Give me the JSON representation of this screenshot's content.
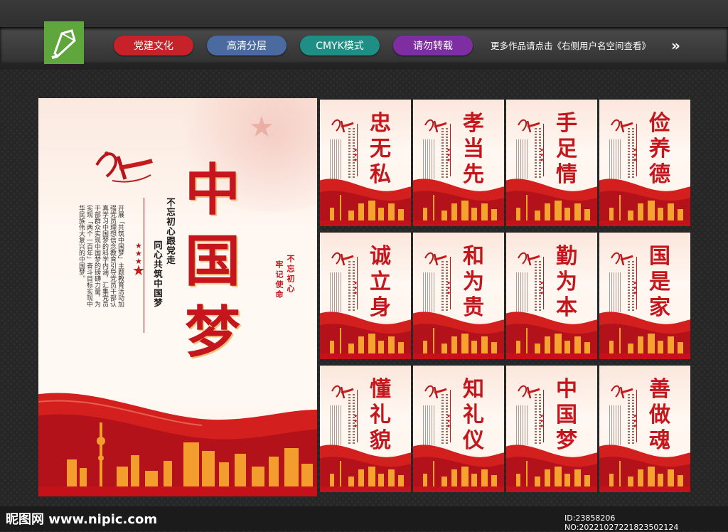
{
  "header": {
    "tags": [
      {
        "label": "党建文化",
        "color": "#c7222a"
      },
      {
        "label": "高清分层",
        "color": "#4a6aa0"
      },
      {
        "label": "CMYK模式",
        "color": "#1f8f86"
      },
      {
        "label": "请勿转载",
        "color": "#7e2ea0"
      }
    ],
    "more_text": "更多作品请点击《右侧用户名空间查看》",
    "arrow": "»"
  },
  "main_poster": {
    "title": "中国梦",
    "subtitle_1": "不忘初心跟党走",
    "subtitle_2": "同心共筑中国梦",
    "body": "开展「共筑中国梦」主题教育活动加强党员理想信念教育引导党员干部认真学习中国梦的科学内涵，汇集党员干部群众实现中国梦的磅礴力量，为实现「两个一百年」奋斗目标实现中华民族伟大复兴的中国梦。",
    "seal": [
      "不忘初心",
      "牢记使命"
    ]
  },
  "posters": [
    {
      "title": "忠无私"
    },
    {
      "title": "孝当先"
    },
    {
      "title": "手足情"
    },
    {
      "title": "俭养德"
    },
    {
      "title": "诚立身"
    },
    {
      "title": "和为贵"
    },
    {
      "title": "勤为本"
    },
    {
      "title": "国是家"
    },
    {
      "title": "懂礼貌"
    },
    {
      "title": "知礼仪"
    },
    {
      "title": "中国梦"
    },
    {
      "title": "善做魂"
    }
  ],
  "footer": {
    "site": "昵图网 www.nipic.com",
    "id_text": "ID:23858206 NO:20221027221823502124"
  },
  "colors": {
    "brand_red": "#c4161c",
    "logo_green": "#5fa63c"
  }
}
